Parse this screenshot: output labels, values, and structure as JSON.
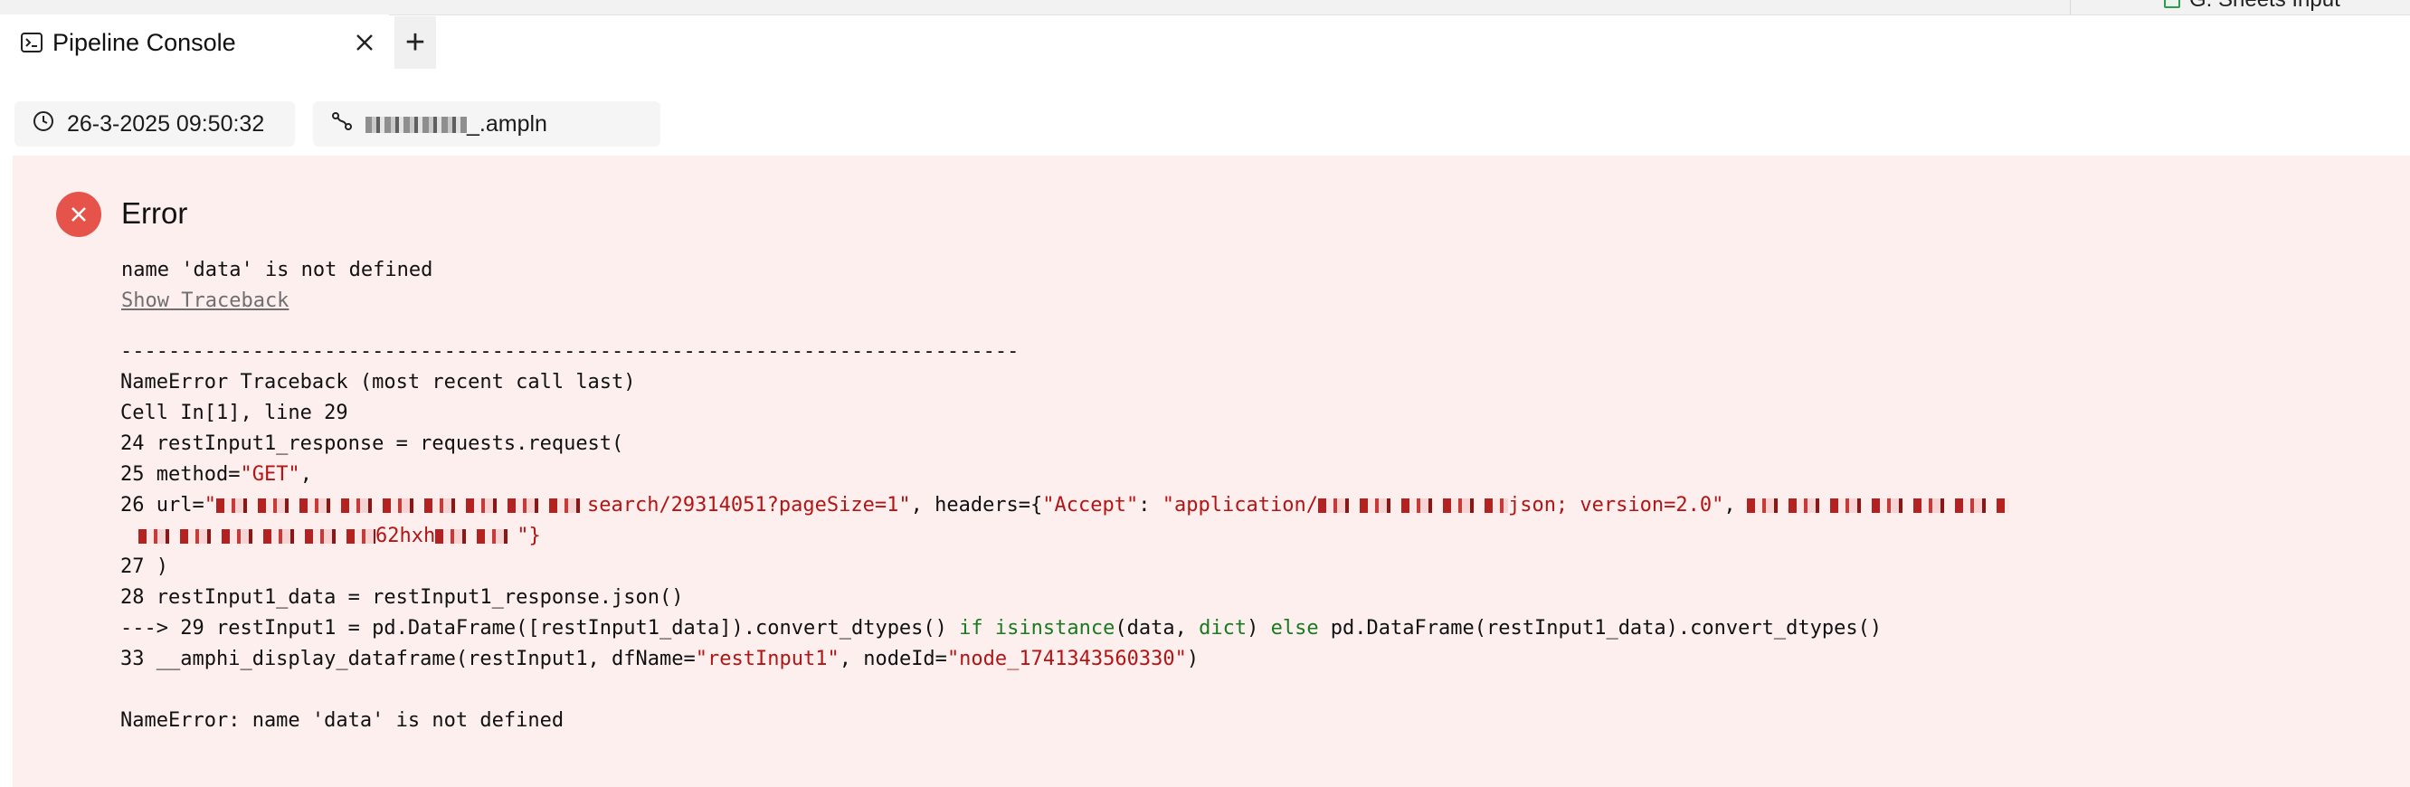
{
  "peek": {
    "text": "G. Sheets Input",
    "icon": "sheet-icon"
  },
  "tab": {
    "title": "Pipeline Console",
    "icon": "terminal-icon",
    "close": "×",
    "add": "+"
  },
  "meta": {
    "timestamp": "26-3-2025 09:50:32",
    "file_visible": "_.ampln",
    "time_icon": "clock-icon",
    "file_icon": "pipeline-icon"
  },
  "error": {
    "title": "Error",
    "icon": "close-circle-icon",
    "message": "name 'data' is not defined",
    "show_traceback": "Show Traceback"
  },
  "traceback": {
    "separator": "---------------------------------------------------------------------------",
    "header": "NameError Traceback (most recent call last)",
    "cell": "Cell In[1], line 29",
    "l24": "24 restInput1_response = requests.request(",
    "l25_a": "25 method=",
    "l25_b": "\"GET\"",
    "l25_c": ",",
    "l26_a": "26 url=",
    "l26_b": "\"",
    "l26_c": "search/29314051?pageSize=1\"",
    "l26_d": ", headers={",
    "l26_e": "\"Accept\"",
    "l26_f": ": ",
    "l26_g": "\"application/",
    "l26_h": "json; version=2.0\"",
    "l26_i": ",",
    "l26b_a": "62hxh",
    "l26b_b": "\"}",
    "l27": "27 )",
    "l28": "28 restInput1_data = restInput1_response.json()",
    "l29_a": "---> 29 restInput1 = pd.DataFrame([restInput1_data]).convert_dtypes() ",
    "l29_b": "if",
    "l29_c": " ",
    "l29_d": "isinstance",
    "l29_e": "(data, ",
    "l29_f": "dict",
    "l29_g": ") ",
    "l29_h": "else",
    "l29_i": " pd.DataFrame(restInput1_data).convert_dtypes()",
    "l33_a": "33 __amphi_display_dataframe(restInput1, dfName=",
    "l33_b": "\"restInput1\"",
    "l33_c": ", nodeId=",
    "l33_d": "\"node_1741343560330\"",
    "l33_e": ")",
    "final": "NameError: name 'data' is not defined"
  }
}
